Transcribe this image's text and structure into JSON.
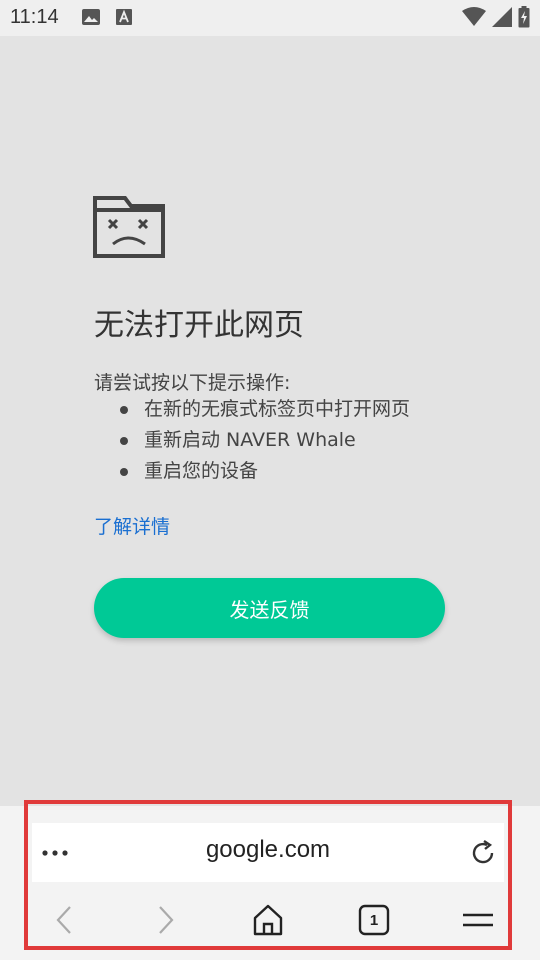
{
  "status_bar": {
    "time": "11:14",
    "icons": [
      "image-icon",
      "text-a-icon",
      "wifi-icon",
      "signal-icon",
      "battery-charging-icon"
    ]
  },
  "error_page": {
    "illustration": "sad-folder-icon",
    "title": "无法打开此网页",
    "intro": "请尝试按以下提示操作:",
    "suggestions": [
      "在新的无痕式标签页中打开网页",
      "重新启动 NAVER Whale",
      "重启您的设备"
    ],
    "learn_more": "了解详情",
    "feedback_button": "发送反馈",
    "accent_color": "#00c996",
    "link_color": "#1a6fd1"
  },
  "address_bar": {
    "more_icon": "more-horizontal-icon",
    "url": "google.com",
    "reload_icon": "reload-icon"
  },
  "bottom_nav": {
    "back_icon": "chevron-left-icon",
    "forward_icon": "chevron-right-icon",
    "home_icon": "home-icon",
    "tab_count": "1",
    "menu_icon": "menu-icon"
  },
  "highlight_color": "#e03a3a"
}
